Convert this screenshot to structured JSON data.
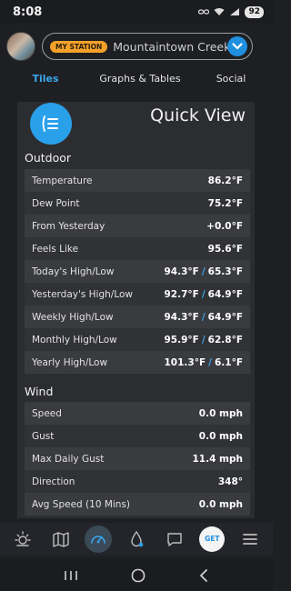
{
  "status": {
    "time": "8:08",
    "battery": "92"
  },
  "header": {
    "badge": "MY STATION",
    "station_name": "Mountaintown Creek R..."
  },
  "tabs": [
    {
      "label": "Tiles"
    },
    {
      "label": "Graphs & Tables"
    },
    {
      "label": "Social"
    }
  ],
  "card": {
    "title": "Quick View",
    "outdoor": {
      "title": "Outdoor",
      "rows": [
        {
          "label": "Temperature",
          "value": "86.2°F"
        },
        {
          "label": "Dew Point",
          "value": "75.2°F"
        },
        {
          "label": "From Yesterday",
          "value": "+0.0°F"
        },
        {
          "label": "Feels Like",
          "value": "95.6°F"
        },
        {
          "label": "Today's High/Low",
          "high": "94.3°F",
          "low": "65.3°F"
        },
        {
          "label": "Yesterday's High/Low",
          "high": "92.7°F",
          "low": "64.9°F"
        },
        {
          "label": "Weekly High/Low",
          "high": "94.3°F",
          "low": "64.9°F"
        },
        {
          "label": "Monthly High/Low",
          "high": "95.9°F",
          "low": "62.8°F"
        },
        {
          "label": "Yearly High/Low",
          "high": "101.3°F",
          "low": "6.1°F"
        }
      ],
      "slash": "/"
    },
    "wind": {
      "title": "Wind",
      "rows": [
        {
          "label": "Speed",
          "value": "0.0 mph"
        },
        {
          "label": "Gust",
          "value": "0.0 mph"
        },
        {
          "label": "Max Daily Gust",
          "value": "11.4 mph"
        },
        {
          "label": "Direction",
          "value": "348°"
        },
        {
          "label": "Avg Speed (10 Mins)",
          "value": "0.0 mph"
        }
      ]
    }
  },
  "bottomnav": {
    "get_label": "GET"
  },
  "colors": {
    "accent": "#2ba0ea",
    "badge": "#f4a12a",
    "card": "#2c2d30"
  }
}
